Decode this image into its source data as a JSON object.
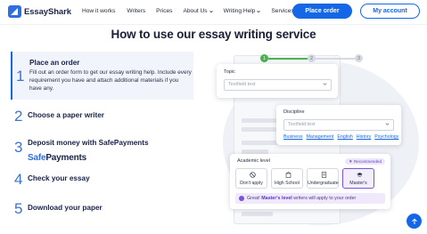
{
  "brand": {
    "name": "EssayShark"
  },
  "nav": [
    {
      "label": "How it works",
      "dropdown": false
    },
    {
      "label": "Writers",
      "dropdown": false
    },
    {
      "label": "Prices",
      "dropdown": false
    },
    {
      "label": "About Us",
      "dropdown": true
    },
    {
      "label": "Writing Help",
      "dropdown": true
    },
    {
      "label": "Services",
      "dropdown": true
    }
  ],
  "header": {
    "place_order": "Place order",
    "my_account": "My account"
  },
  "headline": "How to use our essay writing service",
  "steps": [
    {
      "num": "1",
      "title": "Place an order",
      "desc": "Fill out an order form to get our essay writing help. Include every requirement you have and attach additional materials if you have any.",
      "active": true
    },
    {
      "num": "2",
      "title": "Choose a paper writer"
    },
    {
      "num": "3",
      "title": "Deposit money with SafePayments",
      "logo_safe": "Safe",
      "logo_payments": "Payments"
    },
    {
      "num": "4",
      "title": "Check your essay"
    },
    {
      "num": "5",
      "title": "Download your paper"
    }
  ],
  "illustration": {
    "progress": [
      "1",
      "2",
      "3"
    ],
    "topic": {
      "label": "Topic",
      "placeholder": "Textfield text"
    },
    "discipline": {
      "label": "Discipline",
      "placeholder": "Textfield text",
      "tags": [
        "Business",
        "Management",
        "English",
        "History",
        "Psychology"
      ]
    },
    "academic_level": {
      "label": "Academic level",
      "badge": "Recommended",
      "options": [
        {
          "label": "Don't apply",
          "icon": "ban-icon"
        },
        {
          "label": "High School",
          "icon": "school-icon"
        },
        {
          "label": "Undergraduate",
          "icon": "document-icon"
        },
        {
          "label": "Master's",
          "icon": "graduation-cap-icon",
          "selected": true
        }
      ],
      "notice_prefix": "Great! ",
      "notice_bold": "Master's level",
      "notice_suffix": " writers will apply to your order"
    }
  },
  "colors": {
    "accent": "#1667e6",
    "purple": "#7a55d6",
    "green": "#4caf50"
  }
}
